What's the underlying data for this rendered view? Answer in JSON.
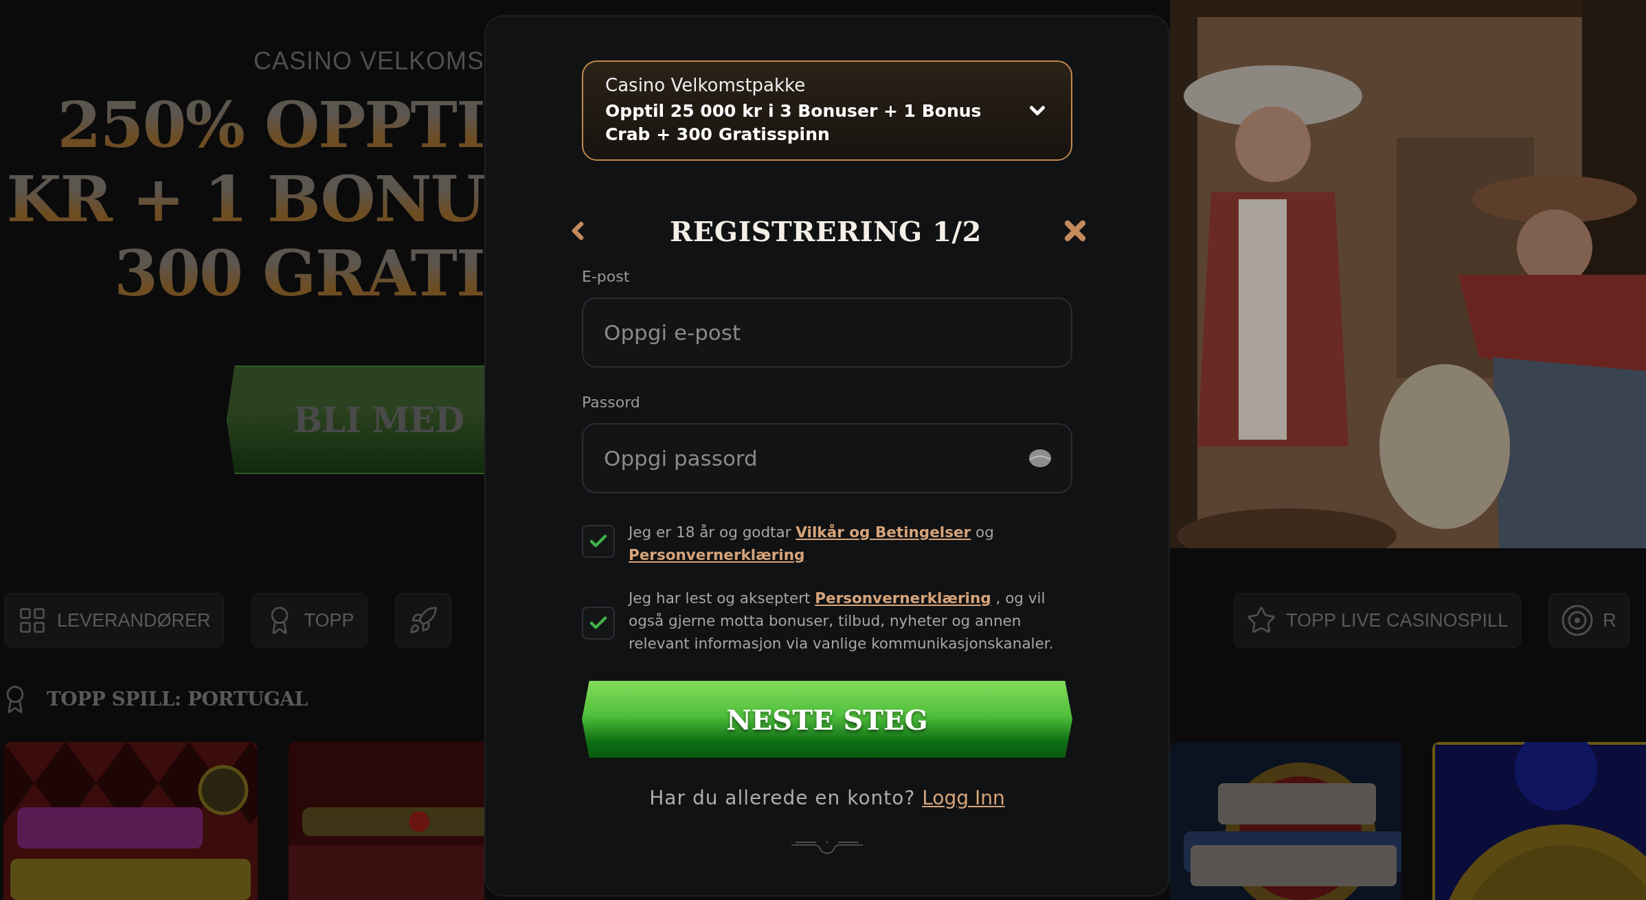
{
  "hero": {
    "eyebrow": "CASINO VELKOMS",
    "headline": [
      "250% OPPTI",
      "KR + 1 BONU",
      "300 GRATI"
    ],
    "cta": "BLI MED"
  },
  "categories_left": [
    {
      "label": "LEVERANDØRER"
    },
    {
      "label": "TOPP"
    }
  ],
  "categories_right": [
    {
      "label": "TOPP LIVE CASINOSPILL"
    },
    {
      "label": "R"
    }
  ],
  "section": {
    "title": "TOPP SPILL: PORTUGAL"
  },
  "modal": {
    "bonus": {
      "title": "Casino Velkomstpakke",
      "offer": "Opptil 25 000 kr i 3 Bonuser + 1 Bonus Crab + 300 Gratisspinn",
      "expanded": false
    },
    "heading": "REGISTRERING 1/2",
    "fields": [
      {
        "kind": "email",
        "label": "E-post",
        "placeholder": "Oppgi e-post"
      },
      {
        "kind": "password",
        "label": "Passord",
        "placeholder": "Oppgi passord"
      }
    ],
    "consents": [
      {
        "checked": true,
        "parts": [
          {
            "kind": "text",
            "text": "Jeg er 18 år og godtar "
          },
          {
            "kind": "link",
            "text": "Vilkår og Betingelser"
          },
          {
            "kind": "text",
            "text": " og "
          },
          {
            "kind": "link",
            "text": "Personvernerklæring"
          }
        ]
      },
      {
        "checked": true,
        "parts": [
          {
            "kind": "text",
            "text": "Jeg har lest og akseptert "
          },
          {
            "kind": "link",
            "text": "Personvernerklæring"
          },
          {
            "kind": "text",
            "text": " , og vil også gjerne motta bonuser, tilbud, nyheter og annen relevant informasjon via vanlige kommunikasjonskanaler."
          }
        ]
      }
    ],
    "submit": "NESTE STEG",
    "login_prompt": "Har du allerede en konto?",
    "login_link": "Logg Inn"
  }
}
